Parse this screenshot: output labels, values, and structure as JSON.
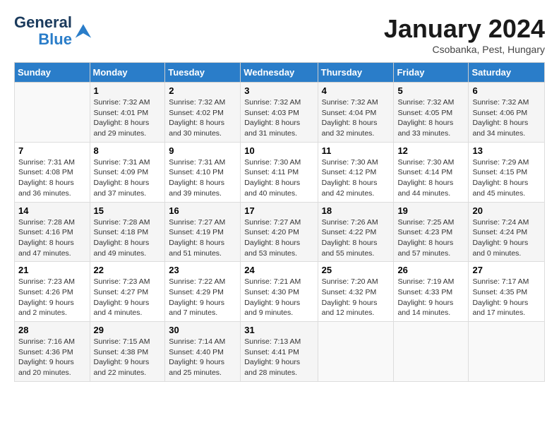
{
  "header": {
    "logo_line1": "General",
    "logo_line2": "Blue",
    "month": "January 2024",
    "location": "Csobanka, Pest, Hungary"
  },
  "weekdays": [
    "Sunday",
    "Monday",
    "Tuesday",
    "Wednesday",
    "Thursday",
    "Friday",
    "Saturday"
  ],
  "weeks": [
    [
      {
        "day": "",
        "sunrise": "",
        "sunset": "",
        "daylight": ""
      },
      {
        "day": "1",
        "sunrise": "7:32 AM",
        "sunset": "4:01 PM",
        "daylight": "8 hours and 29 minutes."
      },
      {
        "day": "2",
        "sunrise": "7:32 AM",
        "sunset": "4:02 PM",
        "daylight": "8 hours and 30 minutes."
      },
      {
        "day": "3",
        "sunrise": "7:32 AM",
        "sunset": "4:03 PM",
        "daylight": "8 hours and 31 minutes."
      },
      {
        "day": "4",
        "sunrise": "7:32 AM",
        "sunset": "4:04 PM",
        "daylight": "8 hours and 32 minutes."
      },
      {
        "day": "5",
        "sunrise": "7:32 AM",
        "sunset": "4:05 PM",
        "daylight": "8 hours and 33 minutes."
      },
      {
        "day": "6",
        "sunrise": "7:32 AM",
        "sunset": "4:06 PM",
        "daylight": "8 hours and 34 minutes."
      }
    ],
    [
      {
        "day": "7",
        "sunrise": "7:31 AM",
        "sunset": "4:08 PM",
        "daylight": "8 hours and 36 minutes."
      },
      {
        "day": "8",
        "sunrise": "7:31 AM",
        "sunset": "4:09 PM",
        "daylight": "8 hours and 37 minutes."
      },
      {
        "day": "9",
        "sunrise": "7:31 AM",
        "sunset": "4:10 PM",
        "daylight": "8 hours and 39 minutes."
      },
      {
        "day": "10",
        "sunrise": "7:30 AM",
        "sunset": "4:11 PM",
        "daylight": "8 hours and 40 minutes."
      },
      {
        "day": "11",
        "sunrise": "7:30 AM",
        "sunset": "4:12 PM",
        "daylight": "8 hours and 42 minutes."
      },
      {
        "day": "12",
        "sunrise": "7:30 AM",
        "sunset": "4:14 PM",
        "daylight": "8 hours and 44 minutes."
      },
      {
        "day": "13",
        "sunrise": "7:29 AM",
        "sunset": "4:15 PM",
        "daylight": "8 hours and 45 minutes."
      }
    ],
    [
      {
        "day": "14",
        "sunrise": "7:28 AM",
        "sunset": "4:16 PM",
        "daylight": "8 hours and 47 minutes."
      },
      {
        "day": "15",
        "sunrise": "7:28 AM",
        "sunset": "4:18 PM",
        "daylight": "8 hours and 49 minutes."
      },
      {
        "day": "16",
        "sunrise": "7:27 AM",
        "sunset": "4:19 PM",
        "daylight": "8 hours and 51 minutes."
      },
      {
        "day": "17",
        "sunrise": "7:27 AM",
        "sunset": "4:20 PM",
        "daylight": "8 hours and 53 minutes."
      },
      {
        "day": "18",
        "sunrise": "7:26 AM",
        "sunset": "4:22 PM",
        "daylight": "8 hours and 55 minutes."
      },
      {
        "day": "19",
        "sunrise": "7:25 AM",
        "sunset": "4:23 PM",
        "daylight": "8 hours and 57 minutes."
      },
      {
        "day": "20",
        "sunrise": "7:24 AM",
        "sunset": "4:24 PM",
        "daylight": "9 hours and 0 minutes."
      }
    ],
    [
      {
        "day": "21",
        "sunrise": "7:23 AM",
        "sunset": "4:26 PM",
        "daylight": "9 hours and 2 minutes."
      },
      {
        "day": "22",
        "sunrise": "7:23 AM",
        "sunset": "4:27 PM",
        "daylight": "9 hours and 4 minutes."
      },
      {
        "day": "23",
        "sunrise": "7:22 AM",
        "sunset": "4:29 PM",
        "daylight": "9 hours and 7 minutes."
      },
      {
        "day": "24",
        "sunrise": "7:21 AM",
        "sunset": "4:30 PM",
        "daylight": "9 hours and 9 minutes."
      },
      {
        "day": "25",
        "sunrise": "7:20 AM",
        "sunset": "4:32 PM",
        "daylight": "9 hours and 12 minutes."
      },
      {
        "day": "26",
        "sunrise": "7:19 AM",
        "sunset": "4:33 PM",
        "daylight": "9 hours and 14 minutes."
      },
      {
        "day": "27",
        "sunrise": "7:17 AM",
        "sunset": "4:35 PM",
        "daylight": "9 hours and 17 minutes."
      }
    ],
    [
      {
        "day": "28",
        "sunrise": "7:16 AM",
        "sunset": "4:36 PM",
        "daylight": "9 hours and 20 minutes."
      },
      {
        "day": "29",
        "sunrise": "7:15 AM",
        "sunset": "4:38 PM",
        "daylight": "9 hours and 22 minutes."
      },
      {
        "day": "30",
        "sunrise": "7:14 AM",
        "sunset": "4:40 PM",
        "daylight": "9 hours and 25 minutes."
      },
      {
        "day": "31",
        "sunrise": "7:13 AM",
        "sunset": "4:41 PM",
        "daylight": "9 hours and 28 minutes."
      },
      {
        "day": "",
        "sunrise": "",
        "sunset": "",
        "daylight": ""
      },
      {
        "day": "",
        "sunrise": "",
        "sunset": "",
        "daylight": ""
      },
      {
        "day": "",
        "sunrise": "",
        "sunset": "",
        "daylight": ""
      }
    ]
  ],
  "labels": {
    "sunrise": "Sunrise:",
    "sunset": "Sunset:",
    "daylight": "Daylight:"
  }
}
